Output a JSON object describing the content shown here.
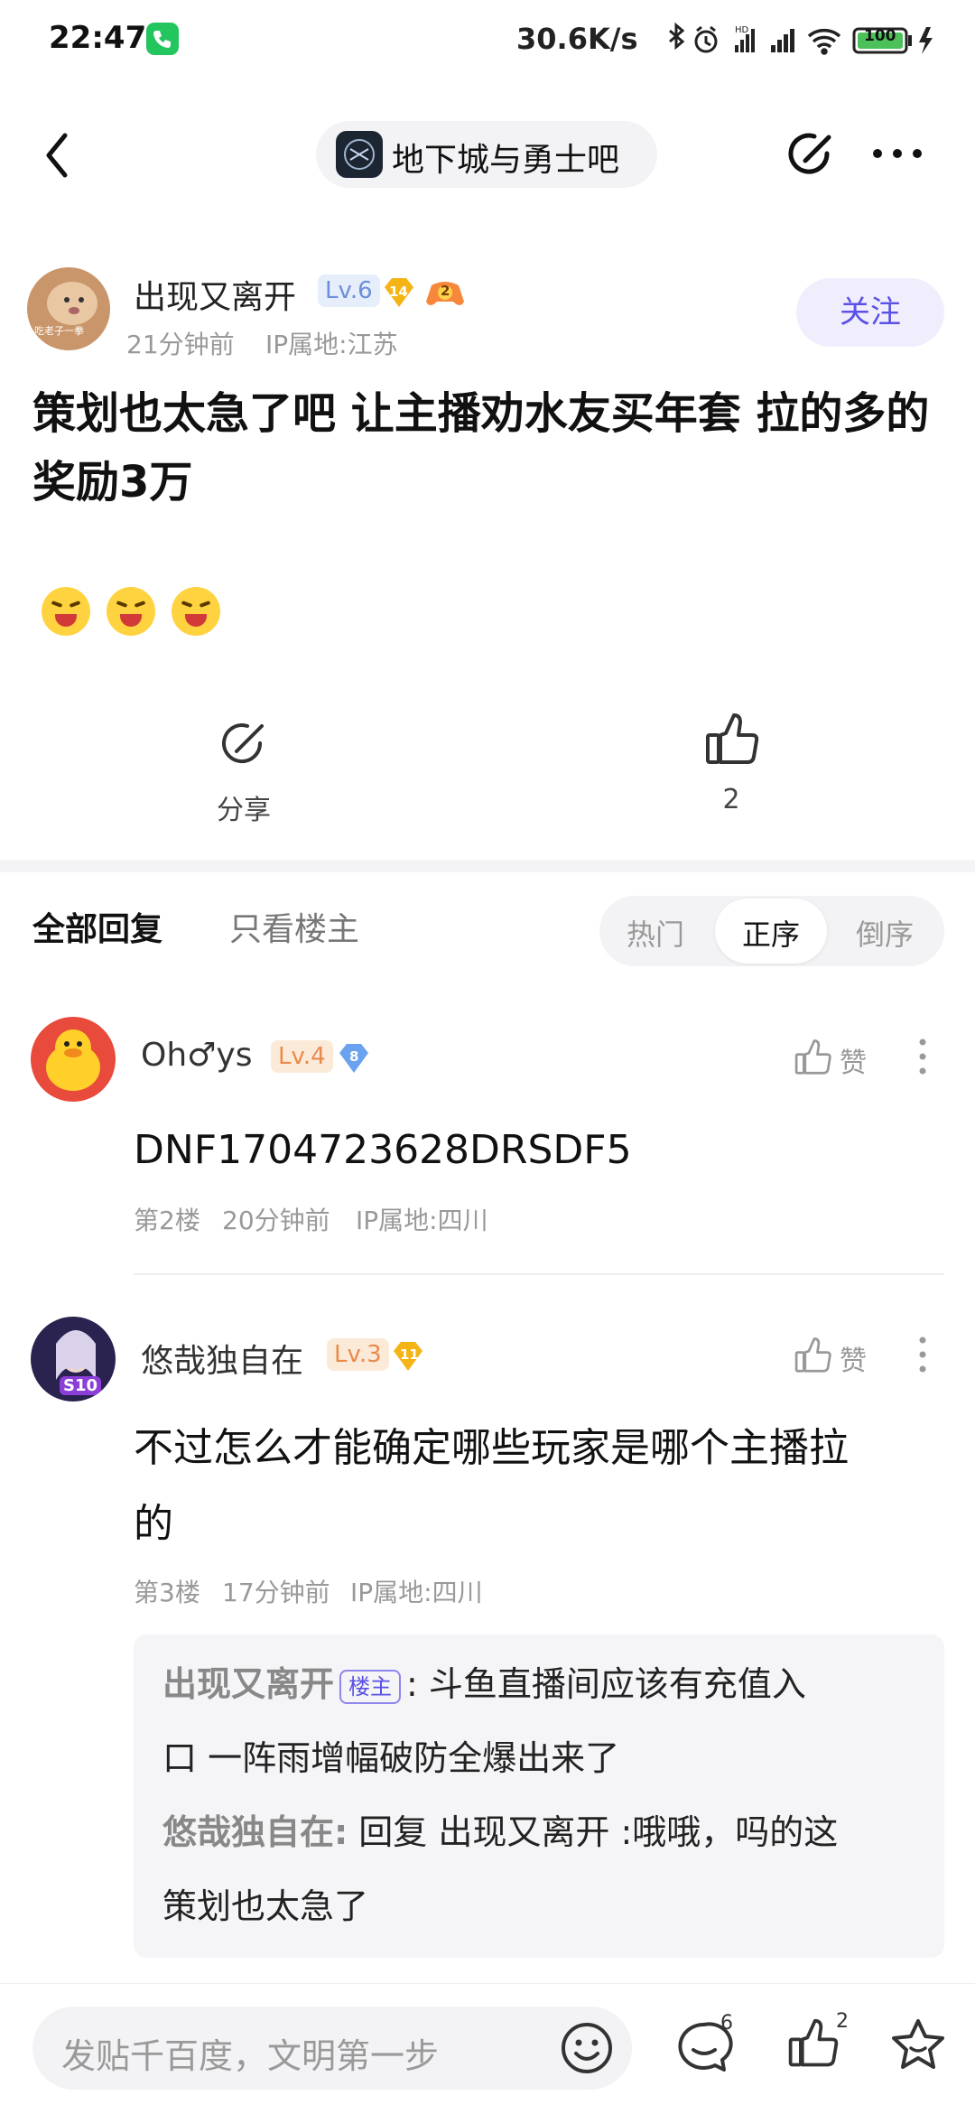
{
  "status_bar": {
    "time": "22:47",
    "speed": "30.6K/s",
    "battery": "100",
    "icons": [
      "bluetooth-icon",
      "alarm-icon",
      "signal-hd-icon",
      "signal-icon",
      "wifi-icon",
      "battery-icon",
      "charging-icon"
    ]
  },
  "nav": {
    "forum_name": "地下城与勇士吧",
    "icons": [
      "back-icon",
      "share-edit-icon",
      "more-icon"
    ]
  },
  "post": {
    "author": "出现又离开",
    "avatar_text": "吃老子一拳",
    "level": "Lv.6",
    "badge_num": "14",
    "badge2_num": "2",
    "time": "21分钟前",
    "ip": "IP属地:江苏",
    "follow_label": "关注",
    "title": "策划也太急了吧 让主播劝水友买年套 拉的多的奖励3万",
    "share_label": "分享",
    "like_count": "2"
  },
  "replies_header": {
    "tab_all": "全部回复",
    "tab_owner": "只看楼主",
    "sort_hot": "热门",
    "sort_asc": "正序",
    "sort_desc": "倒序"
  },
  "replies": [
    {
      "name": "Oh♂ys",
      "level": "Lv.4",
      "badge_num": "8",
      "like_label": "赞",
      "content": "DNF1704723628DRSDF5",
      "floor": "第2楼",
      "time": "20分钟前",
      "ip": "IP属地:四川"
    },
    {
      "name": "悠哉独自在",
      "level": "Lv.3",
      "badge_num": "11",
      "avatar_tag": "S10",
      "like_label": "赞",
      "content_line1": "不过怎么才能确定哪些玩家是哪个主播拉",
      "content_line2": "的",
      "floor": "第3楼",
      "time": "17分钟前",
      "ip": "IP属地:四川",
      "sub_replies": [
        {
          "name": "出现又离开",
          "tag": "楼主",
          "text_line1": ": 斗鱼直播间应该有充值入",
          "text_line2": "口 一阵雨增幅破防全爆出来了"
        },
        {
          "name": "悠哉独自在:",
          "text_line1": " 回复 出现又离开 :哦哦，吗的这",
          "text_line2": "策划也太急了"
        }
      ]
    }
  ],
  "bottom": {
    "input_placeholder": "发贴千百度，文明第一步",
    "comment_count": "6",
    "like_count": "2"
  },
  "colors": {
    "accent": "#5b51e6",
    "follow_bg": "#f0eefc",
    "level_blue": "#6b8fd8",
    "level_orange": "#e98a4a",
    "gold": "#f5b416"
  }
}
